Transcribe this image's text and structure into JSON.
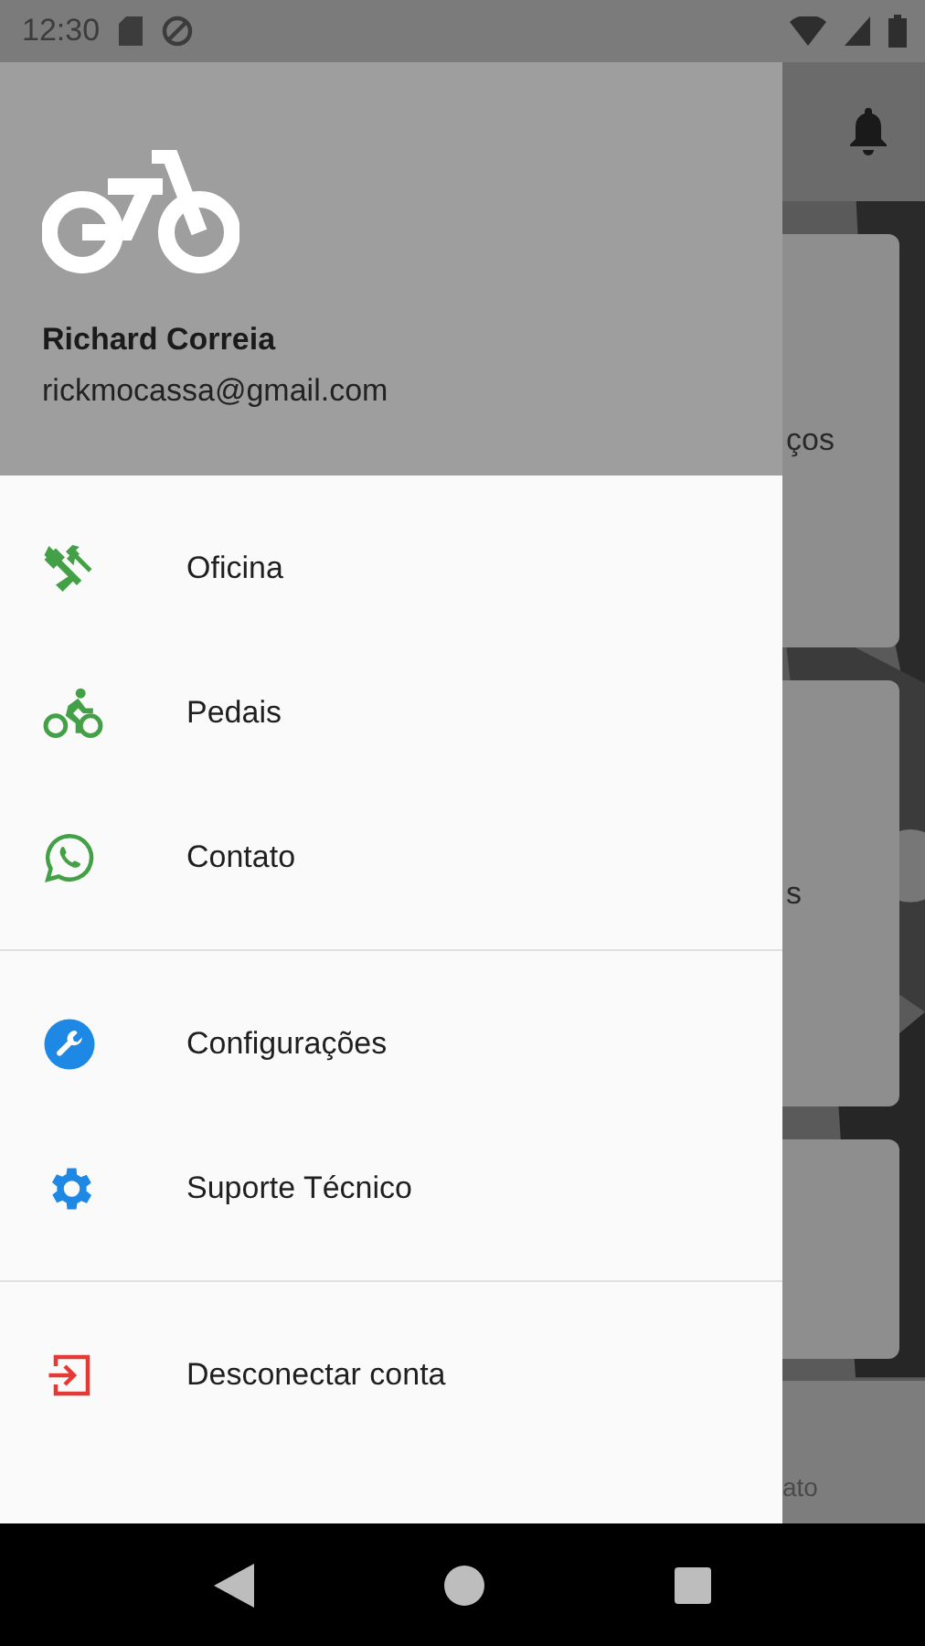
{
  "status_bar": {
    "time": "12:30"
  },
  "drawer": {
    "header": {
      "name": "Richard Correia",
      "email": "rickmocassa@gmail.com"
    },
    "sections": [
      [
        {
          "label": "Oficina",
          "color": "#43a047"
        },
        {
          "label": "Pedais",
          "color": "#43a047"
        },
        {
          "label": "Contato",
          "color": "#43a047"
        }
      ],
      [
        {
          "label": "Configurações",
          "color": "#1e88e5"
        },
        {
          "label": "Suporte Técnico",
          "color": "#1e88e5"
        }
      ],
      [
        {
          "label": "Desconectar conta",
          "color": "#e53935"
        }
      ]
    ]
  },
  "background": {
    "cards": [
      {
        "text": "ços"
      },
      {
        "text": "s"
      }
    ],
    "bottom_nav": {
      "label": "ato"
    }
  }
}
